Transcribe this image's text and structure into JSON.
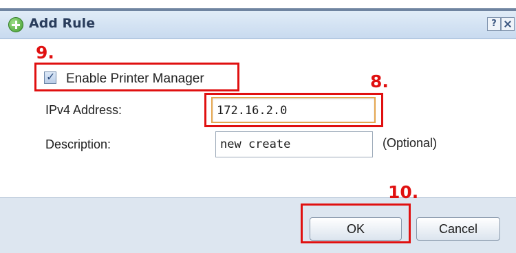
{
  "dialog": {
    "title": "Add Rule",
    "help_label": "?"
  },
  "form": {
    "enable_label": "Enable Printer Manager",
    "enable_checked": true,
    "ipv4_label": "IPv4 Address:",
    "ipv4_value": "172.16.2.0",
    "description_label": "Description:",
    "description_value": "new create",
    "optional_hint": "(Optional)"
  },
  "buttons": {
    "ok_label": "OK",
    "cancel_label": "Cancel"
  },
  "annotations": {
    "step_9": "9.",
    "step_8": "8.",
    "step_10": "10.",
    "color": "#e01010"
  },
  "colors": {
    "title_bar": "#c8daef",
    "footer": "#dde6f0",
    "focus_border": "#e5a64f"
  }
}
